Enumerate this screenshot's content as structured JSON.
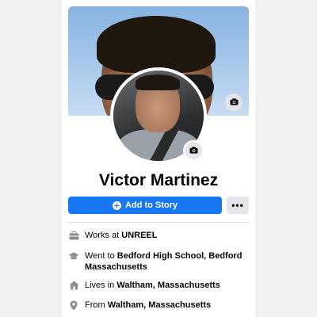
{
  "profile": {
    "name": "Victor Martinez"
  },
  "actions": {
    "add_story_label": "Add to Story",
    "more_label": "•••"
  },
  "details": {
    "work_prefix": "Works at ",
    "work_value": "UNREEL",
    "school_prefix": "Went to ",
    "school_value": "Bedford High School, Bedford Massachusetts",
    "lives_prefix": "Lives in ",
    "lives_value": "Waltham, Massachusetts",
    "from_prefix": "From ",
    "from_value": "Waltham, Massachusetts"
  },
  "icons": {
    "cover_camera": "camera-icon",
    "avatar_camera": "camera-icon",
    "add_story": "plus-circle-icon",
    "work": "briefcase-icon",
    "school": "graduation-cap-icon",
    "lives": "home-icon",
    "from": "location-pin-icon"
  },
  "colors": {
    "accent": "#1877f2",
    "icon_gray": "#8a8d91",
    "button_gray": "#e4e6eb"
  }
}
